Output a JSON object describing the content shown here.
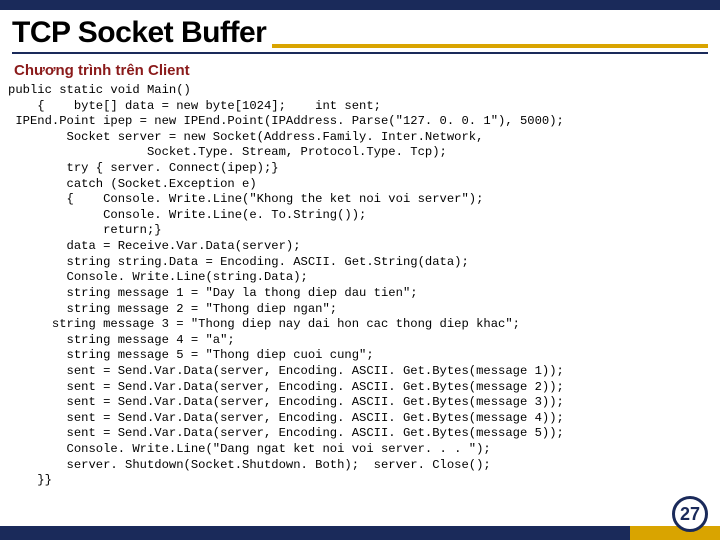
{
  "header": {
    "title": "TCP Socket Buffer",
    "subtitle": "Chương trình trên Client"
  },
  "code": {
    "lines": [
      "public static void Main()",
      "    {    byte[] data = new byte[1024];    int sent;",
      " IPEnd.Point ipep = new IPEnd.Point(IPAddress. Parse(\"127. 0. 0. 1\"), 5000);",
      "        Socket server = new Socket(Address.Family. Inter.Network,",
      "                   Socket.Type. Stream, Protocol.Type. Tcp);",
      "        try { server. Connect(ipep);}",
      "        catch (Socket.Exception e)",
      "        {    Console. Write.Line(\"Khong the ket noi voi server\");",
      "             Console. Write.Line(e. To.String());",
      "             return;}",
      "        data = Receive.Var.Data(server);",
      "        string string.Data = Encoding. ASCII. Get.String(data);",
      "        Console. Write.Line(string.Data);",
      "        string message 1 = \"Day la thong diep dau tien\";",
      "        string message 2 = \"Thong diep ngan\";",
      "      string message 3 = \"Thong diep nay dai hon cac thong diep khac\";",
      "        string message 4 = \"a\";",
      "        string message 5 = \"Thong diep cuoi cung\";",
      "        sent = Send.Var.Data(server, Encoding. ASCII. Get.Bytes(message 1));",
      "        sent = Send.Var.Data(server, Encoding. ASCII. Get.Bytes(message 2));",
      "        sent = Send.Var.Data(server, Encoding. ASCII. Get.Bytes(message 3));",
      "        sent = Send.Var.Data(server, Encoding. ASCII. Get.Bytes(message 4));",
      "        sent = Send.Var.Data(server, Encoding. ASCII. Get.Bytes(message 5));",
      "        Console. Write.Line(\"Dang ngat ket noi voi server. . . \");",
      "        server. Shutdown(Socket.Shutdown. Both);  server. Close();",
      "    }}"
    ]
  },
  "footer": {
    "page_number": "27"
  }
}
